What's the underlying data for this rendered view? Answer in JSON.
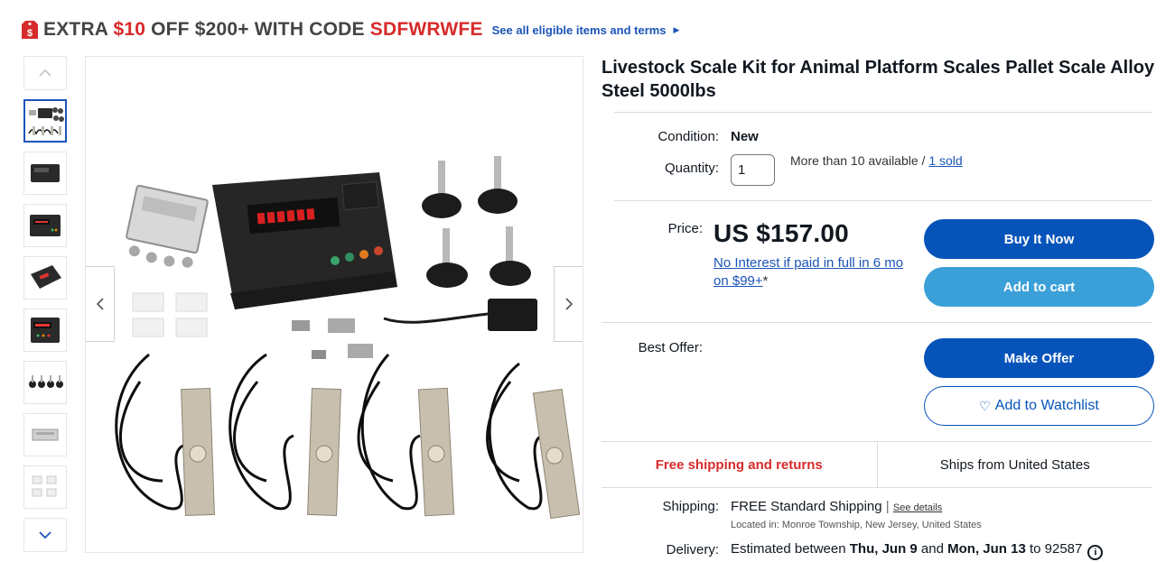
{
  "promo": {
    "prefix": "EXTRA ",
    "amount": "$10",
    "middle": " OFF $200+ WITH CODE ",
    "code": "SDFWRWFE",
    "link": "See all eligible items and terms"
  },
  "gallery": {
    "thumb_count": 8,
    "active_index": 0
  },
  "product": {
    "title": "Livestock Scale Kit for Animal Platform Scales Pallet Scale Alloy Steel 5000lbs"
  },
  "condition": {
    "label": "Condition:",
    "value": "New"
  },
  "quantity": {
    "label": "Quantity:",
    "value": "1",
    "available": "More than 10 available / ",
    "sold": "1 sold"
  },
  "price": {
    "label": "Price:",
    "value": "US $157.00",
    "finance_link": "No Interest if paid in full in 6 mo on $99+",
    "finance_suffix": "*"
  },
  "buttons": {
    "buy_now": "Buy It Now",
    "add_to_cart": "Add to cart",
    "make_offer": "Make Offer",
    "watchlist": "Add to Watchlist"
  },
  "best_offer": {
    "label": "Best Offer:"
  },
  "shipping_box": {
    "free": "Free shipping and returns",
    "ships_from": "Ships from United States"
  },
  "shipping": {
    "label": "Shipping:",
    "free_word": "FREE",
    "method": " Standard Shipping",
    "separator": " | ",
    "details": "See details",
    "location": "Located in: Monroe Township, New Jersey, United States"
  },
  "delivery": {
    "label": "Delivery:",
    "prefix": "Estimated between ",
    "start": "Thu, Jun 9",
    "and": " and ",
    "end": "Mon, Jun 13",
    "suffix": " to 92587"
  },
  "colors": {
    "primary_blue": "#0654ba",
    "cart_blue": "#3ba0d8",
    "promo_red": "#d72b2b",
    "link_blue": "#1b54b8"
  }
}
